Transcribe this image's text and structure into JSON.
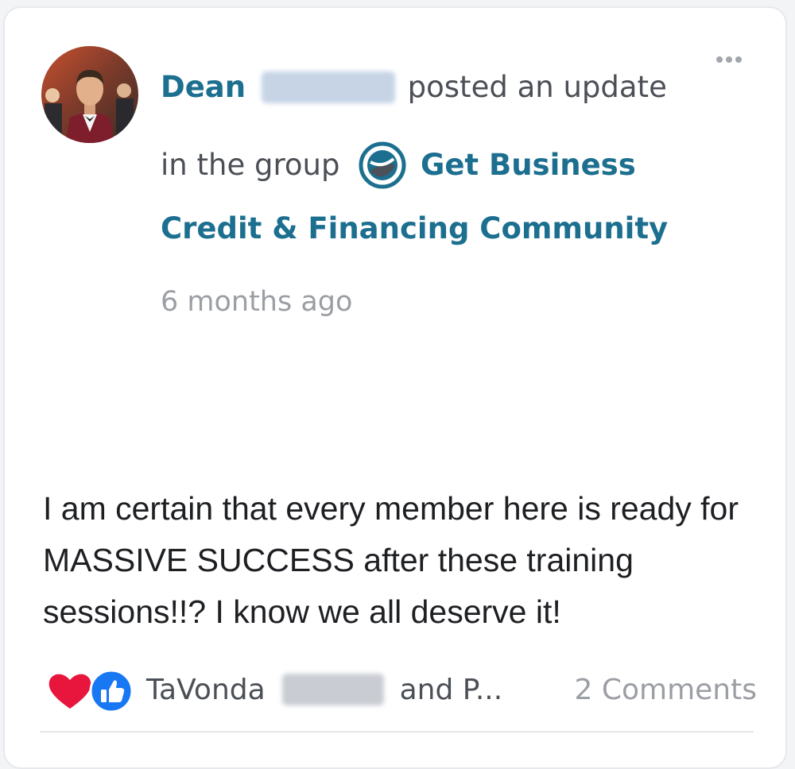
{
  "post": {
    "author_name": "Dean",
    "action_text": "posted an update",
    "in_group_text": "in the group",
    "group_name_part1": "Get Business",
    "group_name_part2": "Credit & Financing Community",
    "timestamp": "6 months ago",
    "body": "I am certain that every member here is ready for MASSIVE SUCCESS after these training sessions!!? I know we all deserve it!"
  },
  "reactions": {
    "icons": [
      "heart-icon",
      "thumbs-up-icon"
    ],
    "first_name": "TaVonda",
    "rest_text": "and P...",
    "comments_text": "2 Comments"
  },
  "colors": {
    "link": "#1c6f8f",
    "heart": "#e8163c",
    "like": "#1877f2",
    "muted": "#9b9ea4",
    "text": "#1d1f22"
  }
}
